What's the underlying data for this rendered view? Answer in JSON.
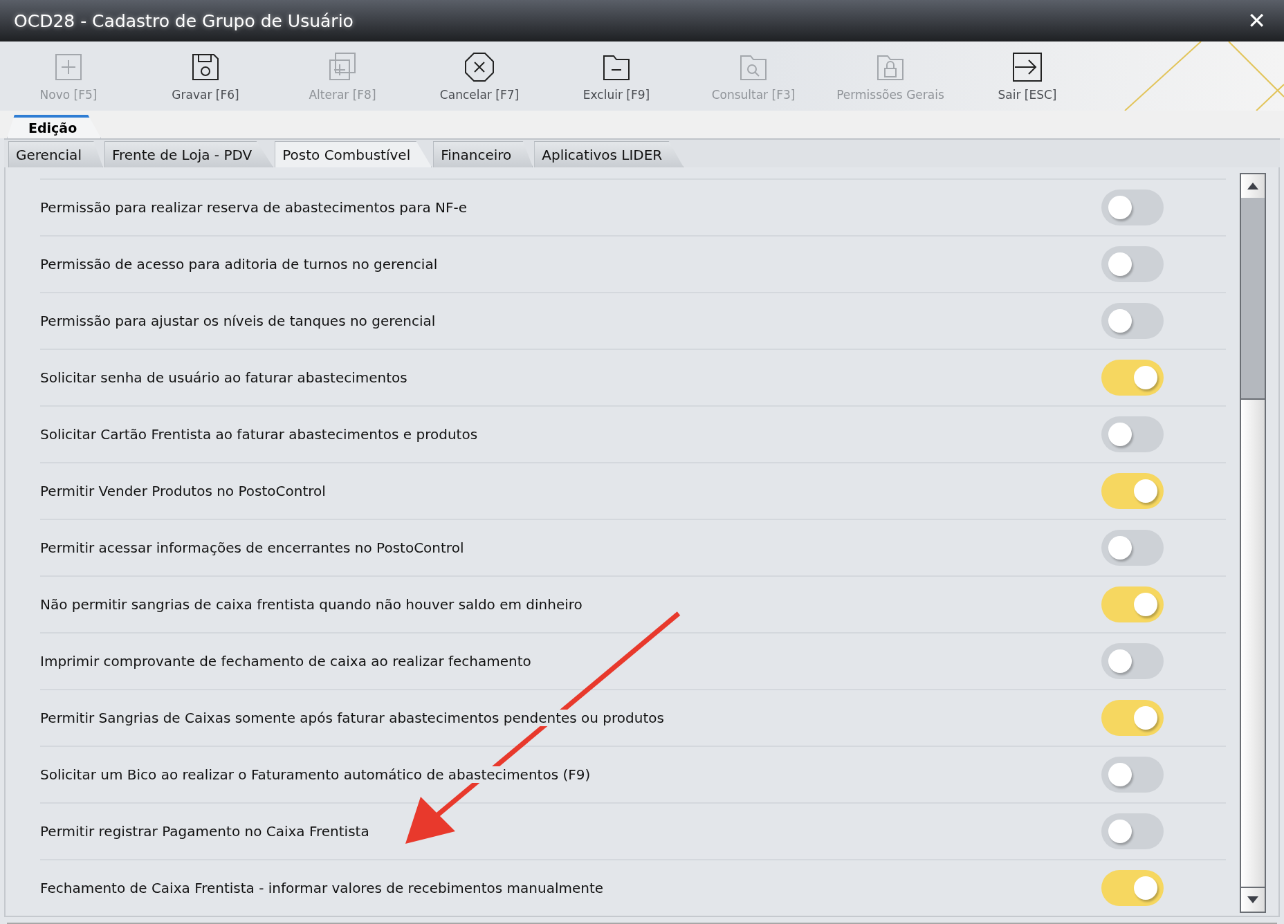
{
  "window": {
    "title": "OCD28 - Cadastro de Grupo de Usuário",
    "close": "✕"
  },
  "toolbar": {
    "buttons": [
      {
        "kind": "add",
        "label": "Novo [F5]",
        "disabled": true
      },
      {
        "kind": "save",
        "label": "Gravar [F6]",
        "disabled": false
      },
      {
        "kind": "edit",
        "label": "Alterar [F8]",
        "disabled": true
      },
      {
        "kind": "cancel",
        "label": "Cancelar [F7]",
        "disabled": false
      },
      {
        "kind": "delete",
        "label": "Excluir [F9]",
        "disabled": false
      },
      {
        "kind": "search",
        "label": "Consultar [F3]",
        "disabled": true
      },
      {
        "kind": "lock",
        "label": "Permissões Gerais",
        "disabled": true
      },
      {
        "kind": "exit",
        "label": "Sair [ESC]",
        "disabled": false
      }
    ]
  },
  "section_tabs": [
    {
      "label": "Edição",
      "selected": true
    }
  ],
  "tabs": [
    {
      "label": "Gerencial",
      "selected": false
    },
    {
      "label": "Frente de Loja - PDV",
      "selected": false
    },
    {
      "label": "Posto Combustível",
      "selected": true
    },
    {
      "label": "Financeiro",
      "selected": false
    },
    {
      "label": "Aplicativos LIDER",
      "selected": false
    }
  ],
  "permissions": [
    {
      "label": "Permissão para realizar reserva de abastecimentos para NF-e",
      "on": false
    },
    {
      "label": "Permissão de acesso para aditoria de turnos no gerencial",
      "on": false
    },
    {
      "label": "Permissão para ajustar os níveis de tanques no gerencial",
      "on": false
    },
    {
      "label": "Solicitar senha de usuário ao faturar abastecimentos",
      "on": true
    },
    {
      "label": "Solicitar Cartão Frentista ao faturar abastecimentos e produtos",
      "on": false
    },
    {
      "label": "Permitir Vender Produtos no PostoControl",
      "on": true
    },
    {
      "label": "Permitir acessar informações de encerrantes no PostoControl",
      "on": false
    },
    {
      "label": "Não permitir sangrias de caixa frentista quando não houver saldo em dinheiro",
      "on": true
    },
    {
      "label": "Imprimir comprovante de fechamento de caixa ao realizar fechamento",
      "on": false
    },
    {
      "label": "Permitir Sangrias de Caixas somente após faturar abastecimentos pendentes ou produtos",
      "on": true
    },
    {
      "label": "Solicitar um Bico ao realizar o Faturamento automático de abastecimentos (F9)",
      "on": false
    },
    {
      "label": "Permitir registrar Pagamento no Caixa Frentista",
      "on": false
    },
    {
      "label": "Fechamento de Caixa Frentista - informar valores de recebimentos manualmente",
      "on": true
    }
  ]
}
